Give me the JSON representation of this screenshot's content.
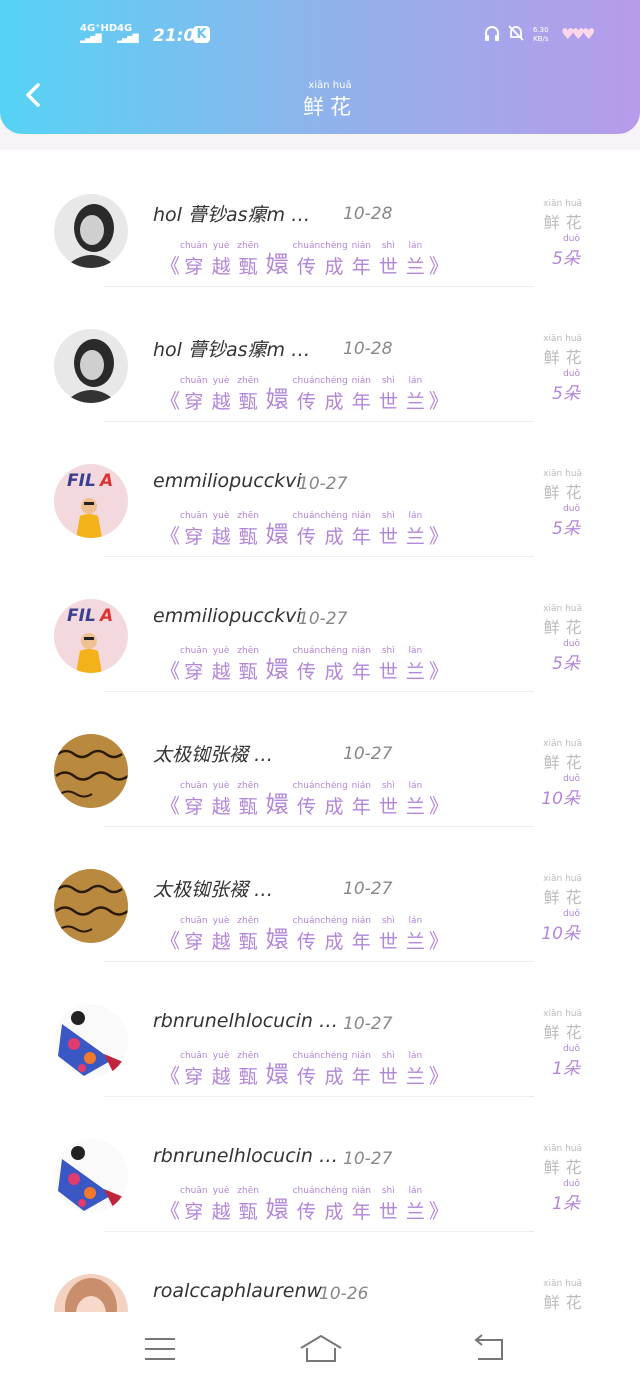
{
  "status_bar": {
    "signal1": "4G⁺HD",
    "signal2": "4G",
    "time": "21:05",
    "k_badge": "K",
    "net_speed": "6.30",
    "net_unit": "KB/s"
  },
  "header": {
    "back_icon": "chevron-left-icon",
    "title_pinyin": "xiān  huā",
    "title": "鲜花"
  },
  "rows": [
    {
      "name": "hol 瞢钞as瘰m …",
      "date": "10-28",
      "gift_pinyin": "xiān  huā",
      "gift": "鲜花",
      "count_pinyin": "duǒ",
      "count": "5朵"
    },
    {
      "name": "hol 瞢钞as瘰m …",
      "date": "10-28",
      "gift_pinyin": "xiān  huā",
      "gift": "鲜花",
      "count_pinyin": "duǒ",
      "count": "5朵"
    },
    {
      "name": "emmiliopucckvi",
      "date": "10-27",
      "gift_pinyin": "xiān  huā",
      "gift": "鲜花",
      "count_pinyin": "duǒ",
      "count": "5朵"
    },
    {
      "name": "emmiliopucckvi",
      "date": "10-27",
      "gift_pinyin": "xiān  huā",
      "gift": "鲜花",
      "count_pinyin": "duǒ",
      "count": "5朵"
    },
    {
      "name": "太极铷张裰 …",
      "date": "10-27",
      "gift_pinyin": "xiān  huā",
      "gift": "鲜花",
      "count_pinyin": "duǒ",
      "count": "10朵"
    },
    {
      "name": "太极铷张裰 …",
      "date": "10-27",
      "gift_pinyin": "xiān  huā",
      "gift": "鲜花",
      "count_pinyin": "duǒ",
      "count": "10朵"
    },
    {
      "name": "rbnrunelhlocucin …",
      "date": "10-27",
      "gift_pinyin": "xiān  huā",
      "gift": "鲜花",
      "count_pinyin": "duǒ",
      "count": "1朵"
    },
    {
      "name": "rbnrunelhlocucin …",
      "date": "10-27",
      "gift_pinyin": "xiān  huā",
      "gift": "鲜花",
      "count_pinyin": "duǒ",
      "count": "1朵"
    },
    {
      "name": "roalccaphlaurenw",
      "date": "10-26",
      "gift_pinyin": "xiān  huā",
      "gift": "鲜花",
      "count_pinyin": "",
      "count": ""
    }
  ],
  "post_title": {
    "open": "《",
    "close": "》",
    "chars": [
      {
        "py": "chuān",
        "hz": "穿"
      },
      {
        "py": "yuè",
        "hz": "越"
      },
      {
        "py": "zhēn",
        "hz": "甄"
      },
      {
        "py": "",
        "hz": "嬛"
      },
      {
        "py": "chuán",
        "hz": "传"
      },
      {
        "py": "chéng",
        "hz": "成"
      },
      {
        "py": "nián",
        "hz": "年"
      },
      {
        "py": "shì",
        "hz": "世"
      },
      {
        "py": "lán",
        "hz": "兰"
      }
    ]
  },
  "avatars": [
    "avatar-woman-bw",
    "avatar-woman-bw",
    "avatar-fila",
    "avatar-fila",
    "avatar-calligraphy",
    "avatar-calligraphy",
    "avatar-kimono",
    "avatar-kimono",
    "avatar-woman-pink"
  ],
  "nav": {
    "menu_icon": "menu-icon",
    "home_icon": "home-icon",
    "back_icon": "return-icon"
  },
  "colors": {
    "accent": "#b286d8",
    "header_start": "#55d3f5",
    "header_end": "#b79bea"
  }
}
